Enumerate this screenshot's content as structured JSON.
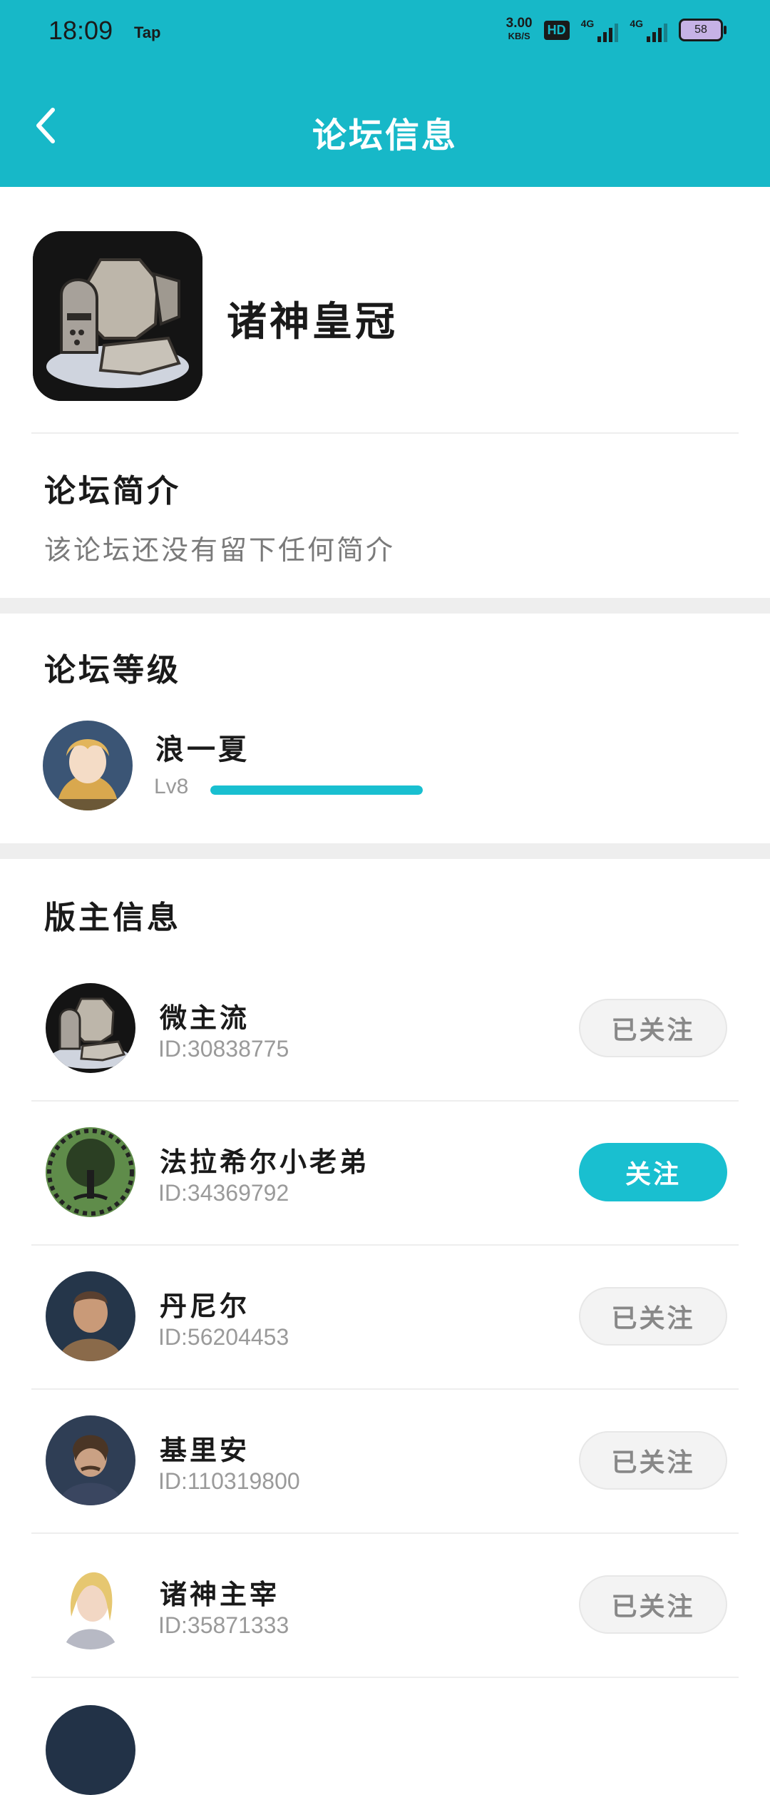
{
  "status_bar": {
    "time": "18:09",
    "app_label": "Tap",
    "net_speed": "3.00",
    "net_unit": "KB/S",
    "hd": "HD",
    "sig1": "4G",
    "sig2": "4G",
    "battery": "58"
  },
  "header": {
    "title": "论坛信息"
  },
  "forum": {
    "name": "诸神皇冠"
  },
  "intro": {
    "title": "论坛简介",
    "text": "该论坛还没有留下任何简介"
  },
  "level": {
    "title": "论坛等级",
    "user": "浪一夏",
    "label": "Lv8",
    "progress": 1.0
  },
  "moderators": {
    "title": "版主信息",
    "items": [
      {
        "name": "微主流",
        "id": "ID:30838775",
        "button": "已关注",
        "following": true
      },
      {
        "name": "法拉希尔小老弟",
        "id": "ID:34369792",
        "button": "关注",
        "following": false
      },
      {
        "name": "丹尼尔",
        "id": "ID:56204453",
        "button": "已关注",
        "following": true
      },
      {
        "name": "基里安",
        "id": "ID:110319800",
        "button": "已关注",
        "following": true
      },
      {
        "name": "诸神主宰",
        "id": "ID:35871333",
        "button": "已关注",
        "following": true
      }
    ]
  },
  "colors": {
    "accent": "#17b8c8",
    "progress": "#19bfd0"
  }
}
